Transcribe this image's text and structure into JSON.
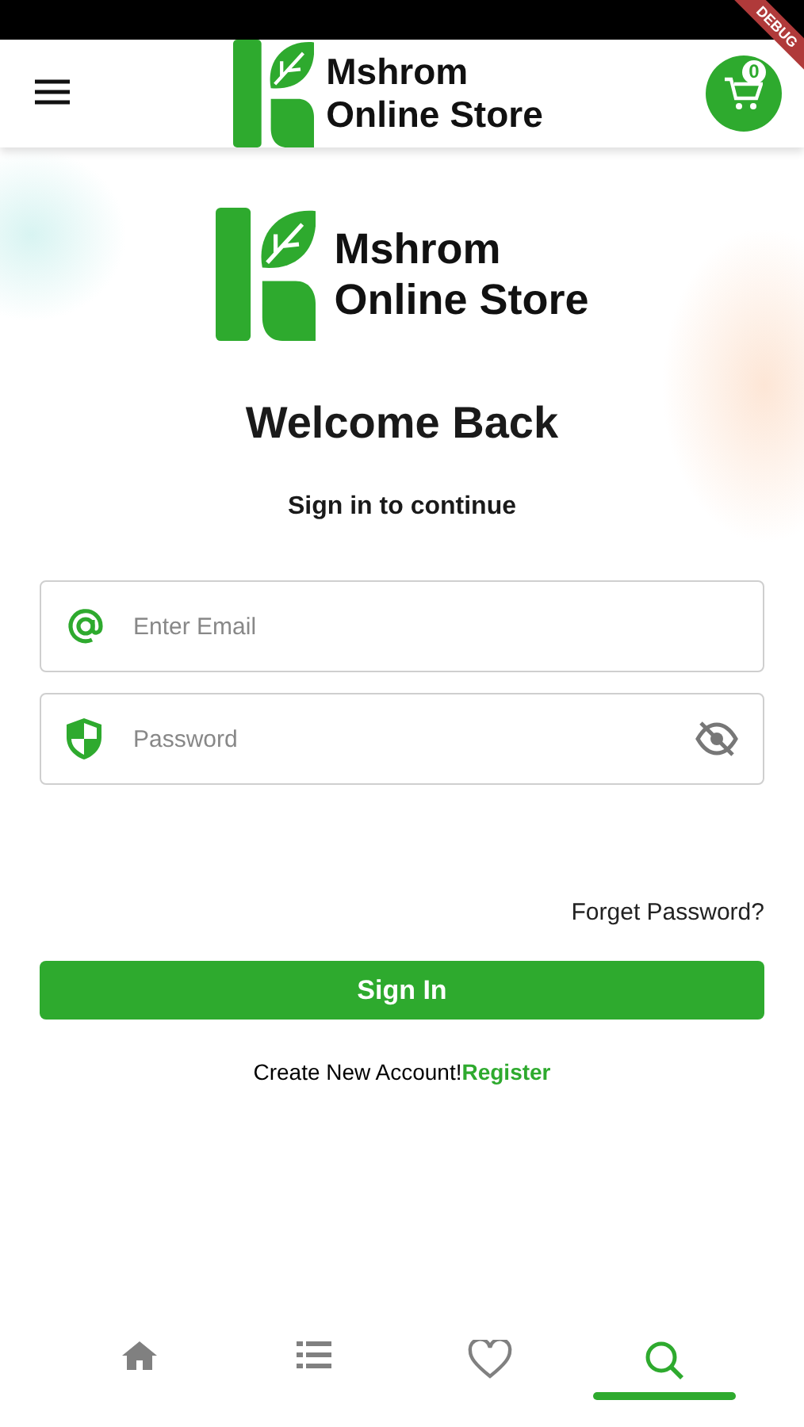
{
  "debug_banner": "DEBUG",
  "header": {
    "logo": {
      "line_1": "Mshrom",
      "line_2": "Online Store"
    },
    "cart_count": "0"
  },
  "logo": {
    "line_1": "Mshrom",
    "line_2": "Online Store"
  },
  "title": "Welcome Back",
  "subtitle": "Sign in to continue",
  "fields": [
    {
      "kind": "email",
      "placeholder": "Enter Email"
    },
    {
      "kind": "password",
      "placeholder": "Password",
      "obscured": true
    }
  ],
  "forgot_link": "Forget Password?",
  "sign_in_button": "Sign In",
  "register": {
    "prompt": "Create New Account!",
    "link": "Register"
  },
  "bottom_nav": [
    {
      "kind": "home",
      "selected": false
    },
    {
      "kind": "list",
      "selected": false
    },
    {
      "kind": "heart",
      "selected": false
    },
    {
      "kind": "search",
      "selected": true
    }
  ]
}
